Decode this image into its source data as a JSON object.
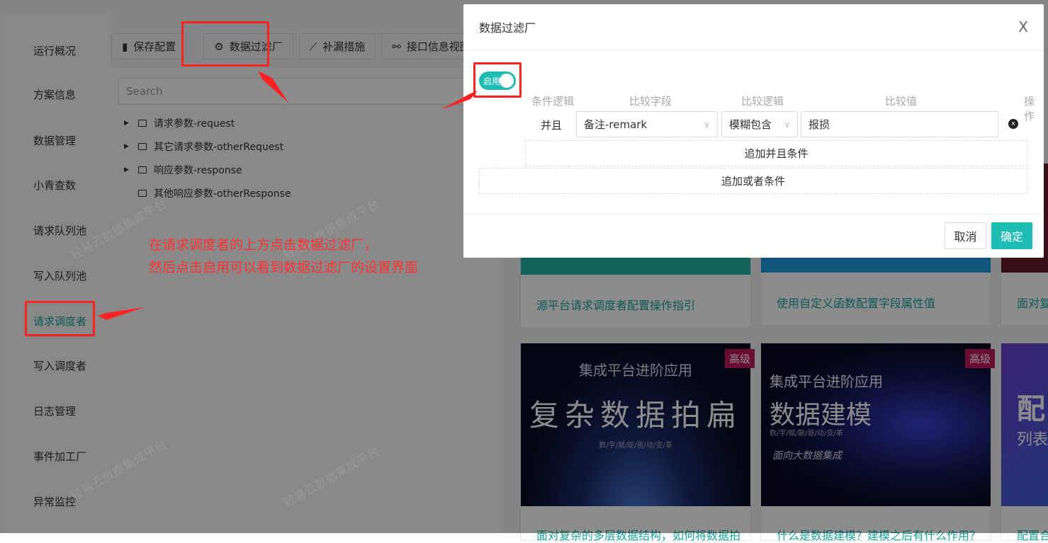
{
  "sidebar": {
    "items": [
      "运行概况",
      "方案信息",
      "数据管理",
      "小青查数",
      "请求队列池",
      "写入队列池",
      "请求调度者",
      "写入调度者",
      "日志管理",
      "事件加工厂",
      "异常监控"
    ],
    "active_index": 6
  },
  "toolbar": {
    "buttons": [
      {
        "label": "保存配置",
        "icon": "save-file-icon"
      },
      {
        "label": "数据过滤厂",
        "icon": "gear-icon"
      },
      {
        "label": "补漏措施",
        "icon": "trend-icon"
      },
      {
        "label": "接口信息视图",
        "icon": "link-icon"
      }
    ]
  },
  "tree": {
    "search_placeholder": "Search",
    "nodes": [
      {
        "label": "请求参数-request",
        "expandable": true
      },
      {
        "label": "其它请求参数-otherRequest",
        "expandable": true
      },
      {
        "label": "响应参数-response",
        "expandable": true
      },
      {
        "label": "其他响应参数-otherResponse",
        "expandable": false
      }
    ]
  },
  "cards": {
    "row1": [
      "源平台请求调度者配置操作指引",
      "使用自定义函数配置字段属性值",
      "面对复"
    ],
    "row2": [
      {
        "badge": "高级",
        "thumb_sub": "集成平台进阶应用",
        "thumb_title": "复杂数据拍扁",
        "thumb_tag": "数/字/赋/能/驱/动/变/革",
        "title": "面对复杂的多层数据结构，如何将数据拍"
      },
      {
        "badge": "高级",
        "thumb_sub": "集成平台进阶应用",
        "thumb_title": "数据建模",
        "thumb_tag": "数/字/赋/能/驱/动/变/革",
        "thumb_extra": "面向大数据集成",
        "title": "什么是数据建模？建模之后有什么作用？"
      },
      {
        "thumb_title": "配",
        "thumb_extra": "列表",
        "title": "配置合"
      }
    ]
  },
  "watermark": "轻易云数据集成平台",
  "modal": {
    "title": "数据过滤厂",
    "close_label": "X",
    "switch": {
      "label": "启用",
      "on": true
    },
    "headers": [
      "条件逻辑",
      "比较字段",
      "比较逻辑",
      "比较值",
      "操作"
    ],
    "row": {
      "logic": "并且",
      "field": "备注-remark",
      "operator": "模糊包含",
      "value": "报损"
    },
    "add_and": "追加并且条件",
    "add_or": "追加或者条件",
    "cancel": "取消",
    "ok": "确定",
    "accent": "#1fbcb3"
  },
  "annotation": {
    "line1": "在请求调度者的上方点击数据过滤厂，",
    "line2": "然后点击启用可以看到数据过滤厂的设置界面",
    "color": "#ff3333"
  }
}
